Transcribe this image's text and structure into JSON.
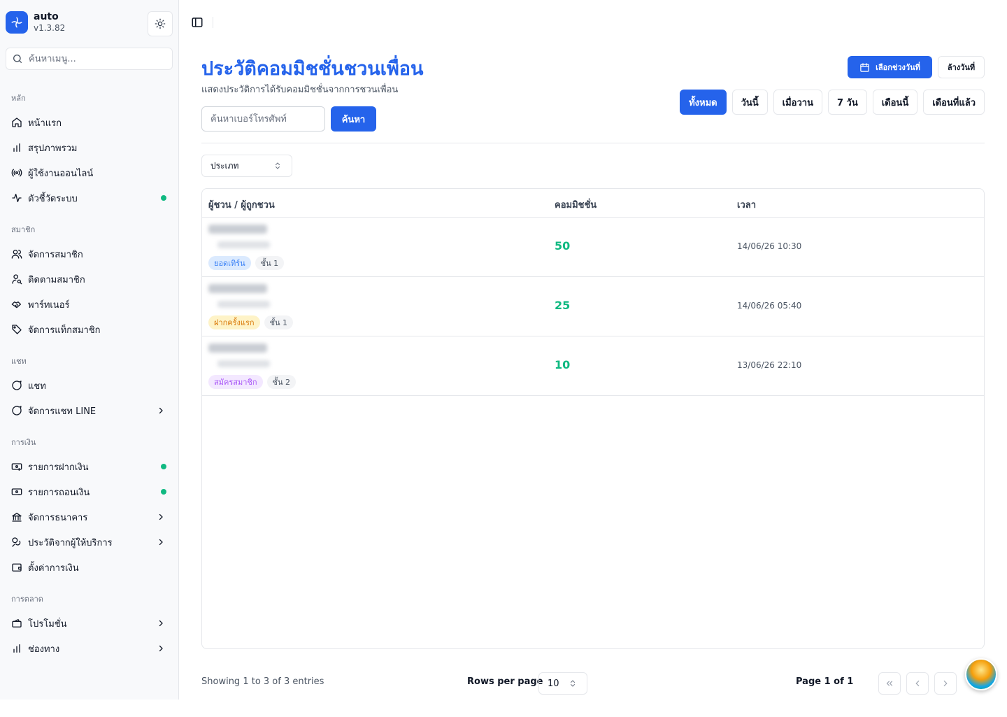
{
  "brand": {
    "name": "auto",
    "version": "v1.3.82"
  },
  "sidebar": {
    "search_placeholder": "ค้นหาเมนู...",
    "groups": [
      {
        "label": "หลัก",
        "items": [
          {
            "label": "หน้าแรก",
            "icon": "home-icon"
          },
          {
            "label": "สรุปภาพรวม",
            "icon": "bar-chart-icon"
          },
          {
            "label": "ผู้ใช้งานออนไลน์",
            "icon": "broadcast-icon"
          },
          {
            "label": "ตัวชี้วัดระบบ",
            "icon": "activity-icon",
            "status_dot": true
          }
        ]
      },
      {
        "label": "สมาชิก",
        "items": [
          {
            "label": "จัดการสมาชิก",
            "icon": "users-icon"
          },
          {
            "label": "ติดตามสมาชิก",
            "icon": "user-search-icon"
          },
          {
            "label": "พาร์ทเนอร์",
            "icon": "handshake-icon"
          },
          {
            "label": "จัดการแท็กสมาชิก",
            "icon": "tag-icon"
          }
        ]
      },
      {
        "label": "แชท",
        "items": [
          {
            "label": "แชท",
            "icon": "chat-icon"
          },
          {
            "label": "จัดการแชท LINE",
            "icon": "chat-icon",
            "has_submenu": true
          }
        ]
      },
      {
        "label": "การเงิน",
        "items": [
          {
            "label": "รายการฝากเงิน",
            "icon": "deposit-icon",
            "status_dot": true
          },
          {
            "label": "รายการถอนเงิน",
            "icon": "withdraw-icon",
            "status_dot": true
          },
          {
            "label": "จัดการธนาคาร",
            "icon": "bank-icon",
            "has_submenu": true
          },
          {
            "label": "ประวัติจากผู้ให้บริการ",
            "icon": "coins-icon",
            "has_submenu": true
          },
          {
            "label": "ตั้งค่าการเงิน",
            "icon": "wallet-icon"
          }
        ]
      },
      {
        "label": "การตลาด",
        "items": [
          {
            "label": "โปรโมชั่น",
            "icon": "promotion-icon",
            "has_submenu": true
          },
          {
            "label": "ช่องทาง",
            "icon": "bar-chart-icon",
            "has_submenu": true
          }
        ]
      }
    ]
  },
  "header": {
    "title": "ประวัติคอมมิชชั่นชวนเพื่อน",
    "subtitle": "แสดงประวัติการได้รับคอมมิชชั่นจากการชวนเพื่อน"
  },
  "search": {
    "placeholder": "ค้นหาเบอร์โทรศัพท์",
    "value": "",
    "button": "ค้นหา"
  },
  "date_range": {
    "pick_label": "เลือกช่วงวันที่",
    "clear_label": "ล้างวันที่"
  },
  "quick_filters": [
    {
      "label": "ทั้งหมด",
      "active": true
    },
    {
      "label": "วันนี้",
      "active": false
    },
    {
      "label": "เมื่อวาน",
      "active": false
    },
    {
      "label": "7 วัน",
      "active": false
    },
    {
      "label": "เดือนนี้",
      "active": false
    },
    {
      "label": "เดือนที่แล้ว",
      "active": false
    }
  ],
  "type_filter": {
    "label": "ประเภท"
  },
  "table": {
    "columns": [
      "ผู้ชวน / ผู้ถูกชวน",
      "คอมมิชชั่น",
      "เวลา"
    ],
    "rows": [
      {
        "type": "ยอดเทิร์น",
        "type_color": "blue",
        "tier": "ชั้น 1",
        "commission": "50",
        "time": "14/06/26 10:30"
      },
      {
        "type": "ฝากครั้งแรก",
        "type_color": "amber",
        "tier": "ชั้น 1",
        "commission": "25",
        "time": "14/06/26 05:40"
      },
      {
        "type": "สมัครสมาชิก",
        "type_color": "purple",
        "tier": "ชั้น 2",
        "commission": "10",
        "time": "13/06/26 22:10"
      }
    ]
  },
  "pagination": {
    "info": "Showing 1 to 3 of 3 entries",
    "rows_per_page_label": "Rows per page",
    "rows_per_page": "10",
    "page_label": "Page 1 of 1"
  },
  "colors": {
    "accent": "#2563eb",
    "success": "#10b981"
  }
}
